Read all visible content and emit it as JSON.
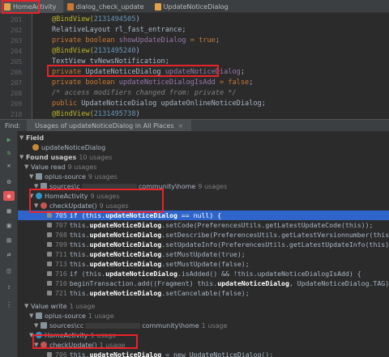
{
  "tabs": [
    {
      "label": "HomeActivity",
      "icon": "java-file-icon",
      "active": true
    },
    {
      "label": "dialog_check_update",
      "icon": "xml-file-icon",
      "active": false
    },
    {
      "label": "UpdateNoticeDialog",
      "icon": "java-file-icon",
      "active": false
    }
  ],
  "editor": {
    "lines": [
      {
        "n": "201",
        "a": "",
        "b": "@BindView(",
        "c": "2131494505",
        "d": ")"
      },
      {
        "n": "202",
        "a": "",
        "b": "RelativeLayout rl_fast_entrance;",
        "c": "",
        "d": ""
      },
      {
        "n": "203",
        "a": "private boolean ",
        "b": "showUpdateDialog",
        "c": " = true",
        "d": ";"
      },
      {
        "n": "204",
        "a": "",
        "b": "@BindView(",
        "c": "2131495240",
        "d": ")"
      },
      {
        "n": "205",
        "a": "",
        "b": "TextView tvNewsNotification;",
        "c": "",
        "d": ""
      },
      {
        "n": "206",
        "a": "private ",
        "b": "UpdateNoticeDialog ",
        "c": "updateNoticeDialog",
        "d": ";"
      },
      {
        "n": "207",
        "a": "private boolean ",
        "b": "updateNoticeDialogIsAdd",
        "c": " = false",
        "d": ";"
      },
      {
        "n": "208",
        "a": "",
        "b": "/* access modifiers changed from: private */",
        "c": "",
        "d": ""
      },
      {
        "n": "209",
        "a": "public ",
        "b": "UpdateNoticeDialog updateOnlineNoticeDialog;",
        "c": "",
        "d": ""
      },
      {
        "n": "210",
        "a": "",
        "b": "@BindView(",
        "c": "2131495738",
        "d": ")"
      }
    ]
  },
  "find": {
    "label": "Find:",
    "tab_label": "Usages of updateNoticeDialog in All Places"
  },
  "tree": {
    "field_group": "Field",
    "field_name": "updateNoticeDialog",
    "found_usages": "Found usages",
    "found_count": "10 usages",
    "value_read": "Value read",
    "value_read_count": "9 usages",
    "module1": "oplus-source",
    "module1_count": "9 usages",
    "path1": "sources\\c",
    "path1_tail": "community\\home",
    "path1_count": "9 usages",
    "class1": "HomeActivity",
    "class1_count": "9 usages",
    "method1": "checkUpdate()",
    "method1_count": "9 usages",
    "usages": [
      {
        "ln": "705",
        "pre": "if (this.",
        "hl": "updateNoticeDialog",
        "post": " == null) {"
      },
      {
        "ln": "707",
        "pre": "this.",
        "hl": "updateNoticeDialog",
        "post": ".setCode(PreferencesUtils.getLatestUpdateCode(this));"
      },
      {
        "ln": "708",
        "pre": "this.",
        "hl": "updateNoticeDialog",
        "post": ".setDescribe(PreferencesUtils.getLatestVersionnumber(this));"
      },
      {
        "ln": "709",
        "pre": "this.",
        "hl": "updateNoticeDialog",
        "post": ".setUpdateInfo(PreferencesUtils.getLatestUpdateInfo(this));"
      },
      {
        "ln": "711",
        "pre": "this.",
        "hl": "updateNoticeDialog",
        "post": ".setMustUpdate(true);"
      },
      {
        "ln": "713",
        "pre": "this.",
        "hl": "updateNoticeDialog",
        "post": ".setMustUpdate(false);"
      },
      {
        "ln": "716",
        "pre": "if (this.",
        "hl": "updateNoticeDialog",
        "post": ".isAdded() && !this.updateNoticeDialogIsAdd) {"
      },
      {
        "ln": "710",
        "pre": "beginTransaction.add((Fragment) this.",
        "hl": "updateNoticeDialog",
        "post": ", UpdateNoticeDialog.TAG);"
      },
      {
        "ln": "721",
        "pre": "this.",
        "hl": "updateNoticeDialog",
        "post": ".setCancelable(false);"
      }
    ],
    "value_write": "Value write",
    "value_write_count": "1 usage",
    "module2": "oplus-source",
    "module2_count": "1 usage",
    "path2": "sources\\cc",
    "path2_tail": "community\\home",
    "path2_count": "1 usage",
    "class2": "HomeActivity",
    "class2_count": "1 usage",
    "method2": "checkUpdate()",
    "method2_count": "1 usage",
    "write_usage": {
      "ln": "706",
      "pre": "this.",
      "hl": "updateNoticeDialog",
      "post": " = new UpdateNoticeDialog();"
    }
  },
  "colors": {
    "accent_red": "#e8232a",
    "selection": "#2f65ca",
    "background": "#2b2b2b"
  }
}
